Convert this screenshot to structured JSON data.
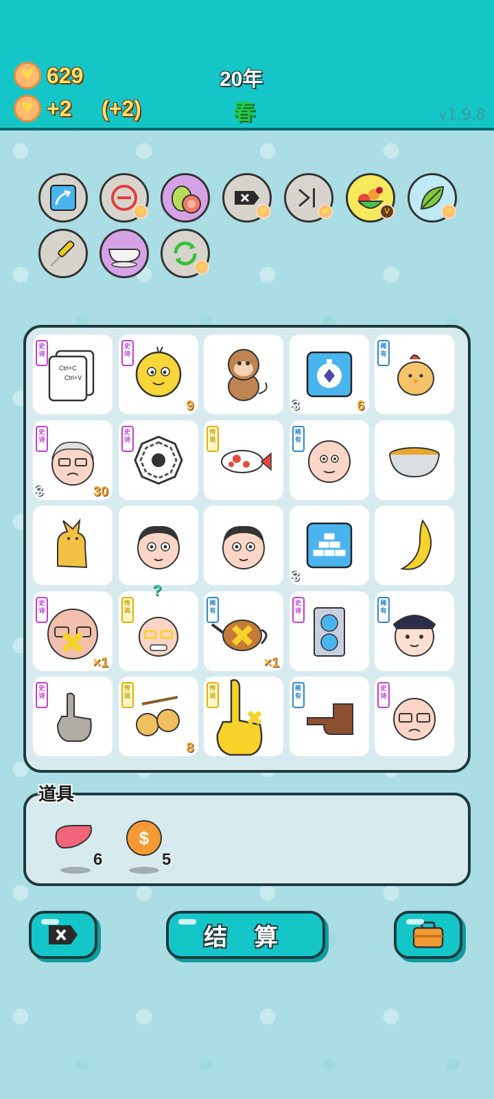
{
  "header": {
    "coins": "629",
    "income": "+2",
    "income_bonus": "(+2)",
    "year": "20年",
    "season": "春",
    "version": "v1.9.8"
  },
  "tools": [
    {
      "name": "arrow-up-right-icon"
    },
    {
      "name": "remove-minus-icon"
    },
    {
      "name": "guava-icon"
    },
    {
      "name": "delete-tag-icon"
    },
    {
      "name": "skip-icon"
    },
    {
      "name": "fruit-basket-icon"
    },
    {
      "name": "leaf-icon"
    },
    {
      "name": "screwdriver-icon"
    },
    {
      "name": "gravy-boat-icon"
    },
    {
      "name": "refresh-icon"
    }
  ],
  "board": {
    "cells": [
      {
        "icon": "copy-paste-icon",
        "rarity": "史诗",
        "copy_text": "Ctrl+C\nCtrl+V"
      },
      {
        "icon": "chick-face-icon",
        "rarity": "史诗",
        "right": "9"
      },
      {
        "icon": "monkey-icon"
      },
      {
        "icon": "stopwatch-card-icon",
        "left": "3",
        "right": "6"
      },
      {
        "icon": "chicken-icon",
        "rarity": "稀有"
      },
      {
        "icon": "old-man-icon",
        "rarity": "史诗",
        "left": "3",
        "right": "30"
      },
      {
        "icon": "bagua-icon",
        "rarity": "史诗"
      },
      {
        "icon": "koi-fish-icon",
        "rarity": "传说"
      },
      {
        "icon": "bald-man-icon",
        "rarity": "稀有"
      },
      {
        "icon": "soup-bowl-icon"
      },
      {
        "icon": "cat-icon"
      },
      {
        "icon": "man-face-icon"
      },
      {
        "icon": "man-face-icon"
      },
      {
        "icon": "gold-bars-card-icon",
        "left": "3"
      },
      {
        "icon": "banana-icon"
      },
      {
        "icon": "angry-old-man-icon",
        "rarity": "史诗",
        "right": "×1"
      },
      {
        "icon": "grinning-old-man-icon",
        "rarity": "传说",
        "above": "?"
      },
      {
        "icon": "teapot-icon",
        "rarity": "稀有",
        "right": "×1"
      },
      {
        "icon": "graphics-card-icon",
        "rarity": "史诗"
      },
      {
        "icon": "police-icon",
        "rarity": "稀有"
      },
      {
        "icon": "pointing-hand-icon",
        "rarity": "史诗"
      },
      {
        "icon": "longan-icon",
        "rarity": "传说",
        "right": "8"
      },
      {
        "icon": "golden-hand-icon",
        "rarity": "传说"
      },
      {
        "icon": "pointing-left-hand-icon",
        "rarity": "稀有"
      },
      {
        "icon": "glasses-old-man-icon",
        "rarity": "史诗"
      }
    ]
  },
  "items": {
    "title": "道具",
    "list": [
      {
        "icon": "liver-icon",
        "count": "6"
      },
      {
        "icon": "dollar-coin-icon",
        "count": "5"
      }
    ]
  },
  "buttons": {
    "delete_icon": "delete-tag-icon",
    "settle_label": "结 算",
    "bag_icon": "briefcase-icon"
  },
  "colors": {
    "header": "#15c6c8",
    "background": "#abdde4",
    "coin_text": "#ffe26a",
    "season": "#22c84a"
  }
}
